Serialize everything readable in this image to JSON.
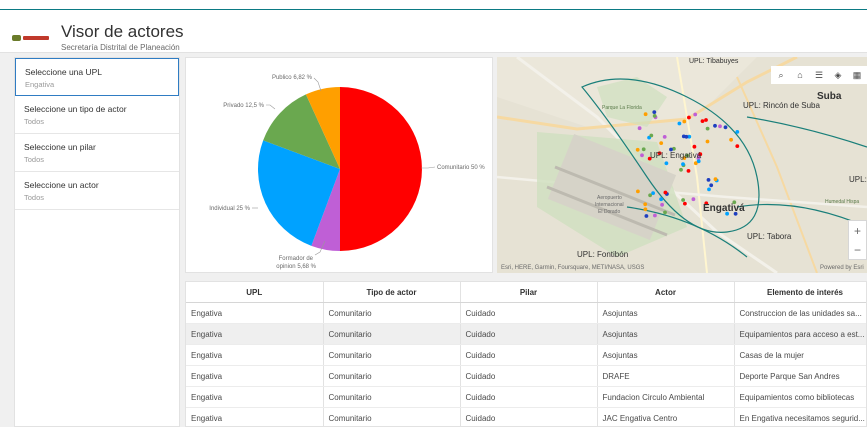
{
  "header": {
    "title": "Visor de actores",
    "subtitle": "Secretaría Distrital de Planeación"
  },
  "filters": [
    {
      "label": "Seleccione una UPL",
      "value": "Engativa"
    },
    {
      "label": "Seleccione un tipo de actor",
      "value": "Todos"
    },
    {
      "label": "Seleccione un pilar",
      "value": "Todos"
    },
    {
      "label": "Seleccione un actor",
      "value": "Todos"
    }
  ],
  "chart_data": {
    "type": "pie",
    "slices": [
      {
        "label": "Comunitario 50 %",
        "value": 50,
        "color": "#ff0000"
      },
      {
        "label": "Formador de opinion 5,68 %",
        "value": 5.68,
        "color": "#bf5fd6"
      },
      {
        "label": "Individual 25 %",
        "value": 25,
        "color": "#00a2ff"
      },
      {
        "label": "Privado 12,5 %",
        "value": 12.5,
        "color": "#6aa84f"
      },
      {
        "label": "Publico 6,82 %",
        "value": 6.82,
        "color": "#ff9f00"
      }
    ]
  },
  "pie_labels": {
    "comunitario": "Comunitario 50 %",
    "formador_1": "Formador de",
    "formador_2": "opinion 5,68 %",
    "individual": "Individual 25 %",
    "privado": "Privado 12,5 %",
    "publico": "Publico 6,82 %"
  },
  "map": {
    "labels": {
      "tibabuyes": "UPL: Tibabuyes",
      "suba": "Suba",
      "rincon": "UPL: Rincón de Suba",
      "engativa_upl": "UPL: Engativá",
      "engativa": "Engativá",
      "tabora": "UPL: Tabora",
      "fontibon": "UPL: Fontibón",
      "upl_right": "UPL:",
      "parque": "Parque La Florida",
      "aeropuerto_1": "Aeropuerto",
      "aeropuerto_2": "Internacional",
      "aeropuerto_3": "El Dorado",
      "humedal": "Humedal Hispa"
    },
    "attribution": "Esri, HERE, Garmin, Foursquare, METI/NASA, USGS",
    "powered": "Powered by Esri",
    "zoom_in": "+",
    "zoom_out": "−",
    "colors": {
      "actor_points": [
        "#ff0000",
        "#00a2ff",
        "#6aa84f",
        "#ff9f00",
        "#bf5fd6",
        "#1f3fbf"
      ]
    }
  },
  "table": {
    "columns": [
      "UPL",
      "Tipo de actor",
      "Pilar",
      "Actor",
      "Elemento de interés"
    ],
    "rows": [
      [
        "Engativa",
        "Comunitario",
        "Cuidado",
        "Asojuntas",
        "Construccion de las unidades sa..."
      ],
      [
        "Engativa",
        "Comunitario",
        "Cuidado",
        "Asojuntas",
        "Equipamientos para acceso a est..."
      ],
      [
        "Engativa",
        "Comunitario",
        "Cuidado",
        "Asojuntas",
        "Casas de la mujer"
      ],
      [
        "Engativa",
        "Comunitario",
        "Cuidado",
        "DRAFE",
        "Deporte Parque San Andres"
      ],
      [
        "Engativa",
        "Comunitario",
        "Cuidado",
        "Fundacion Circulo Ambiental",
        "Equipamientos como bibliotecas"
      ],
      [
        "Engativa",
        "Comunitario",
        "Cuidado",
        "JAC Engativa Centro",
        "En Engativa necesitamos segurid..."
      ]
    ]
  }
}
